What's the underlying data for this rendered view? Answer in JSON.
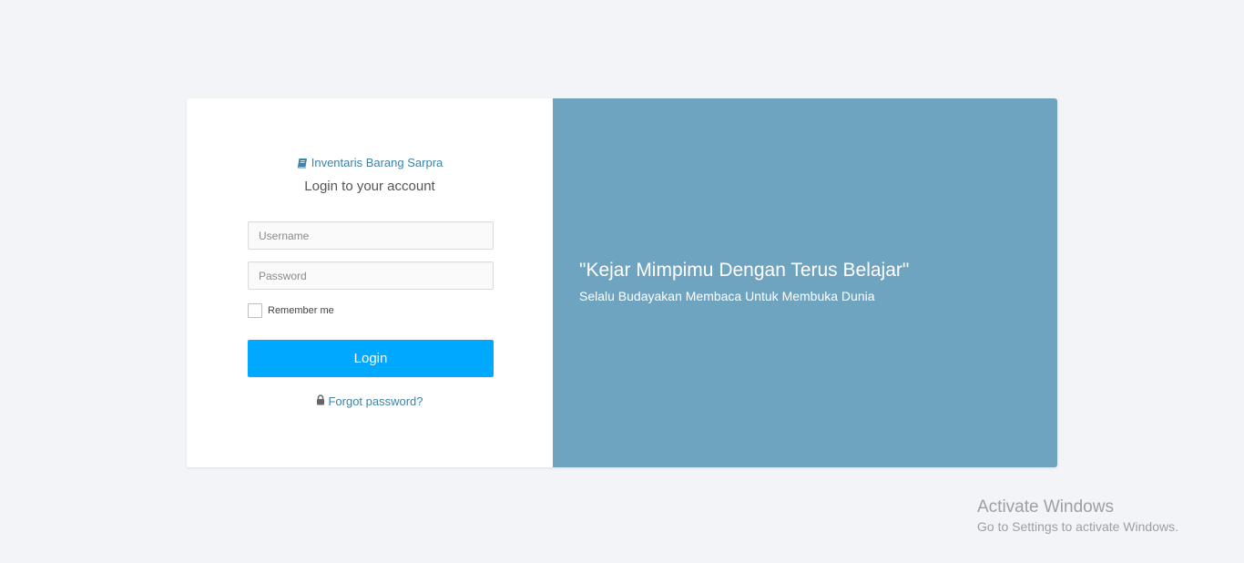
{
  "brand": {
    "icon": "book-icon",
    "label": "Inventaris Barang Sarpra",
    "color": "#3d82a7"
  },
  "login": {
    "subtitle": "Login to your account",
    "username_placeholder": "Username",
    "password_placeholder": "Password",
    "remember_label": "Remember me",
    "button_label": "Login",
    "button_color": "#00a8ff",
    "forgot_icon": "lock-icon",
    "forgot_label": "Forgot password?"
  },
  "hero": {
    "background": "#6fa4c0",
    "quote": "\"Kejar Mimpimu Dengan Terus Belajar\"",
    "tagline": "Selalu Budayakan Membaca Untuk Membuka Dunia"
  },
  "watermark": {
    "title": "Activate Windows",
    "subtitle": "Go to Settings to activate Windows."
  }
}
